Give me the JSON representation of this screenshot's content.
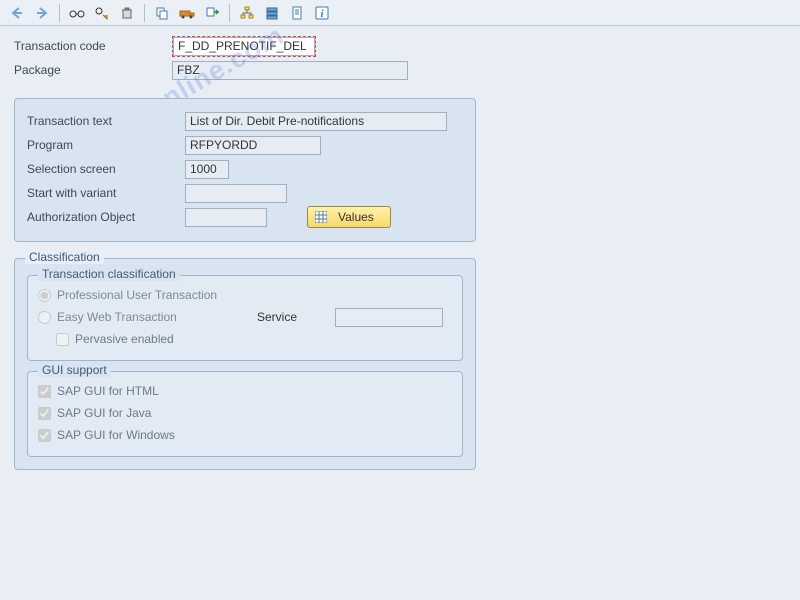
{
  "header": {
    "transaction_code_label": "Transaction code",
    "transaction_code_value": "F_DD_PRENOTIF_DEL",
    "package_label": "Package",
    "package_value": "FBZ"
  },
  "details": {
    "transaction_text_label": "Transaction text",
    "transaction_text_value": "List of Dir. Debit Pre-notifications",
    "program_label": "Program",
    "program_value": "RFPYORDD",
    "selection_screen_label": "Selection screen",
    "selection_screen_value": "1000",
    "start_variant_label": "Start with variant",
    "start_variant_value": "",
    "auth_object_label": "Authorization Object",
    "auth_object_value": "",
    "values_button": "Values"
  },
  "classification": {
    "title": "Classification",
    "trans_class_title": "Transaction classification",
    "prof_user": "Professional User Transaction",
    "easy_web": "Easy Web Transaction",
    "service_label": "Service",
    "service_value": "",
    "pervasive": "Pervasive enabled",
    "gui_title": "GUI support",
    "gui_html": "SAP GUI for HTML",
    "gui_java": "SAP GUI for Java",
    "gui_win": "SAP GUI for Windows"
  },
  "watermark": "sapbrainsonline.com"
}
